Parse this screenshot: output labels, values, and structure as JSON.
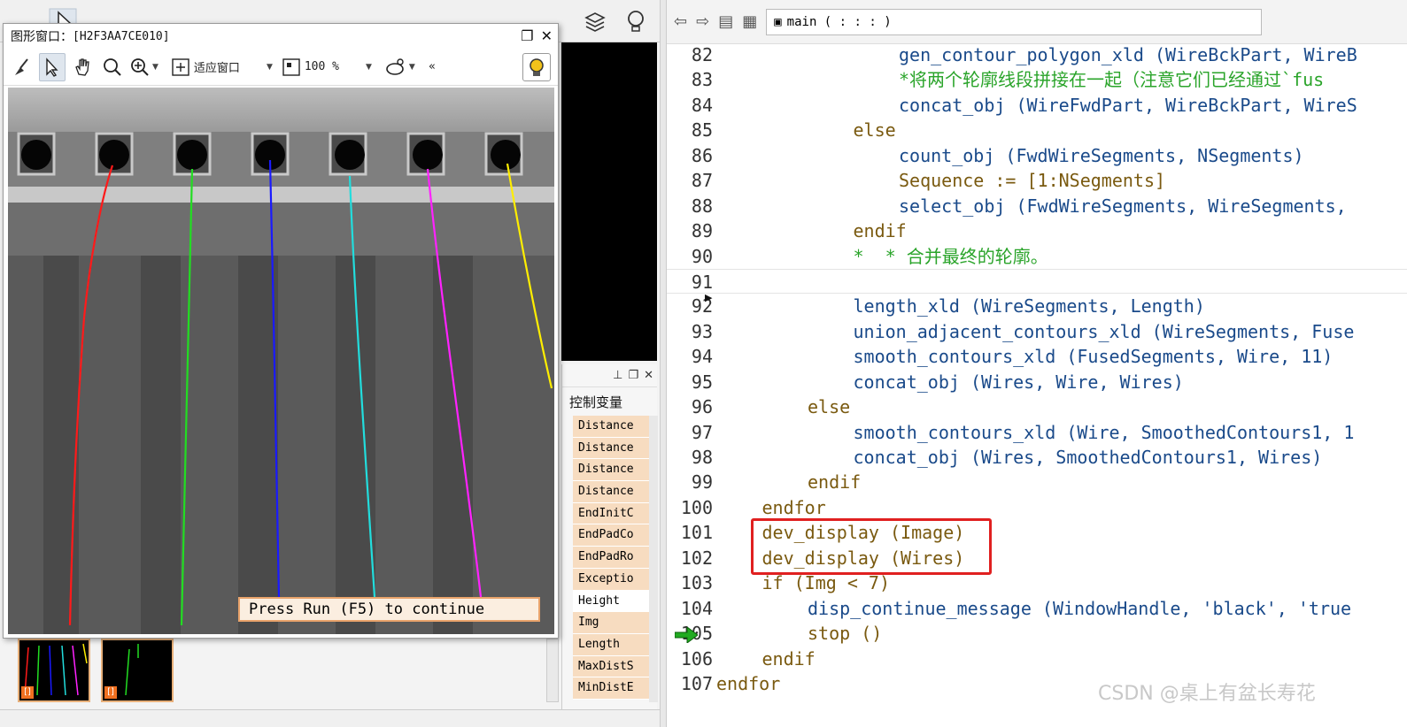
{
  "graphics_window": {
    "title_label": "图形窗口：",
    "title_id": "[H2F3AA7CE010]",
    "toolbar": {
      "fit_window": "适应窗口",
      "zoom": "100 %",
      "more": "«"
    },
    "message": "Press Run (F5) to continue",
    "wire_colors": [
      "#ff1a1a",
      "#22dd22",
      "#1a1aff",
      "#22dddd",
      "#ff22ff",
      "#ffee00"
    ]
  },
  "control_vars": {
    "title": "控制变量",
    "items": [
      "Distance",
      "Distance",
      "Distance",
      "Distance",
      "EndInitC",
      "EndPadCo",
      "EndPadRo",
      "Exceptio",
      "Height",
      "Img",
      "Length",
      "MaxDistS",
      "MinDistE"
    ]
  },
  "editor": {
    "procedure": "main ( : : : )",
    "lines": [
      {
        "n": "82",
        "indent": 4,
        "parts": [
          [
            "op",
            "gen_contour_polygon_xld (WireBckPart, WireB"
          ]
        ]
      },
      {
        "n": "83",
        "indent": 4,
        "parts": [
          [
            "cm",
            "*将两个轮廓线段拼接在一起（注意它们已经通过`fus"
          ]
        ]
      },
      {
        "n": "84",
        "indent": 4,
        "parts": [
          [
            "op",
            "concat_obj (WireFwdPart, WireBckPart, WireS"
          ]
        ]
      },
      {
        "n": "85",
        "indent": 3,
        "parts": [
          [
            "kw",
            "else"
          ]
        ]
      },
      {
        "n": "86",
        "indent": 4,
        "parts": [
          [
            "op",
            "count_obj (FwdWireSegments, NSegments)"
          ]
        ]
      },
      {
        "n": "87",
        "indent": 4,
        "parts": [
          [
            "seq",
            "Sequence := [1:NSegments]"
          ]
        ]
      },
      {
        "n": "88",
        "indent": 4,
        "parts": [
          [
            "op",
            "select_obj (FwdWireSegments, WireSegments, "
          ]
        ]
      },
      {
        "n": "89",
        "indent": 3,
        "parts": [
          [
            "kw",
            "endif"
          ]
        ]
      },
      {
        "n": "90",
        "indent": 3,
        "parts": [
          [
            "cm",
            "*  * 合并最终的轮廓。"
          ]
        ]
      },
      {
        "n": "91",
        "indent": 0,
        "parts": [
          [
            "op",
            ""
          ]
        ],
        "sep": true
      },
      {
        "n": "92",
        "indent": 3,
        "parts": [
          [
            "op",
            "length_xld (WireSegments, Length)"
          ]
        ]
      },
      {
        "n": "93",
        "indent": 3,
        "parts": [
          [
            "op",
            "union_adjacent_contours_xld (WireSegments, Fuse"
          ]
        ]
      },
      {
        "n": "94",
        "indent": 3,
        "parts": [
          [
            "op",
            "smooth_contours_xld (FusedSegments, Wire, 11)"
          ]
        ]
      },
      {
        "n": "95",
        "indent": 3,
        "parts": [
          [
            "op",
            "concat_obj (Wires, Wire, Wires)"
          ]
        ]
      },
      {
        "n": "96",
        "indent": 2,
        "parts": [
          [
            "kw",
            "else"
          ]
        ]
      },
      {
        "n": "97",
        "indent": 3,
        "parts": [
          [
            "op",
            "smooth_contours_xld (Wire, SmoothedContours1, 1"
          ]
        ]
      },
      {
        "n": "98",
        "indent": 3,
        "parts": [
          [
            "op",
            "concat_obj (Wires, SmoothedContours1, Wires)"
          ]
        ]
      },
      {
        "n": "99",
        "indent": 2,
        "parts": [
          [
            "kw",
            "endif"
          ]
        ]
      },
      {
        "n": "100",
        "indent": 1,
        "parts": [
          [
            "kw",
            "endfor"
          ]
        ]
      },
      {
        "n": "101",
        "indent": 1,
        "parts": [
          [
            "kw",
            "dev_display (Image)"
          ]
        ]
      },
      {
        "n": "102",
        "indent": 1,
        "parts": [
          [
            "kw",
            "dev_display (Wires)"
          ]
        ]
      },
      {
        "n": "103",
        "indent": 1,
        "parts": [
          [
            "kw",
            "if (Img < 7)"
          ]
        ]
      },
      {
        "n": "104",
        "indent": 2,
        "parts": [
          [
            "op",
            "disp_continue_message (WindowHandle, 'black', 'true"
          ]
        ]
      },
      {
        "n": "105",
        "indent": 2,
        "parts": [
          [
            "kw",
            "stop ()"
          ]
        ]
      },
      {
        "n": "106",
        "indent": 1,
        "parts": [
          [
            "kw",
            "endif"
          ]
        ]
      },
      {
        "n": "107",
        "indent": 0,
        "parts": [
          [
            "kw",
            "endfor"
          ]
        ]
      }
    ]
  },
  "watermark": "CSDN @桌上有盆长寿花"
}
